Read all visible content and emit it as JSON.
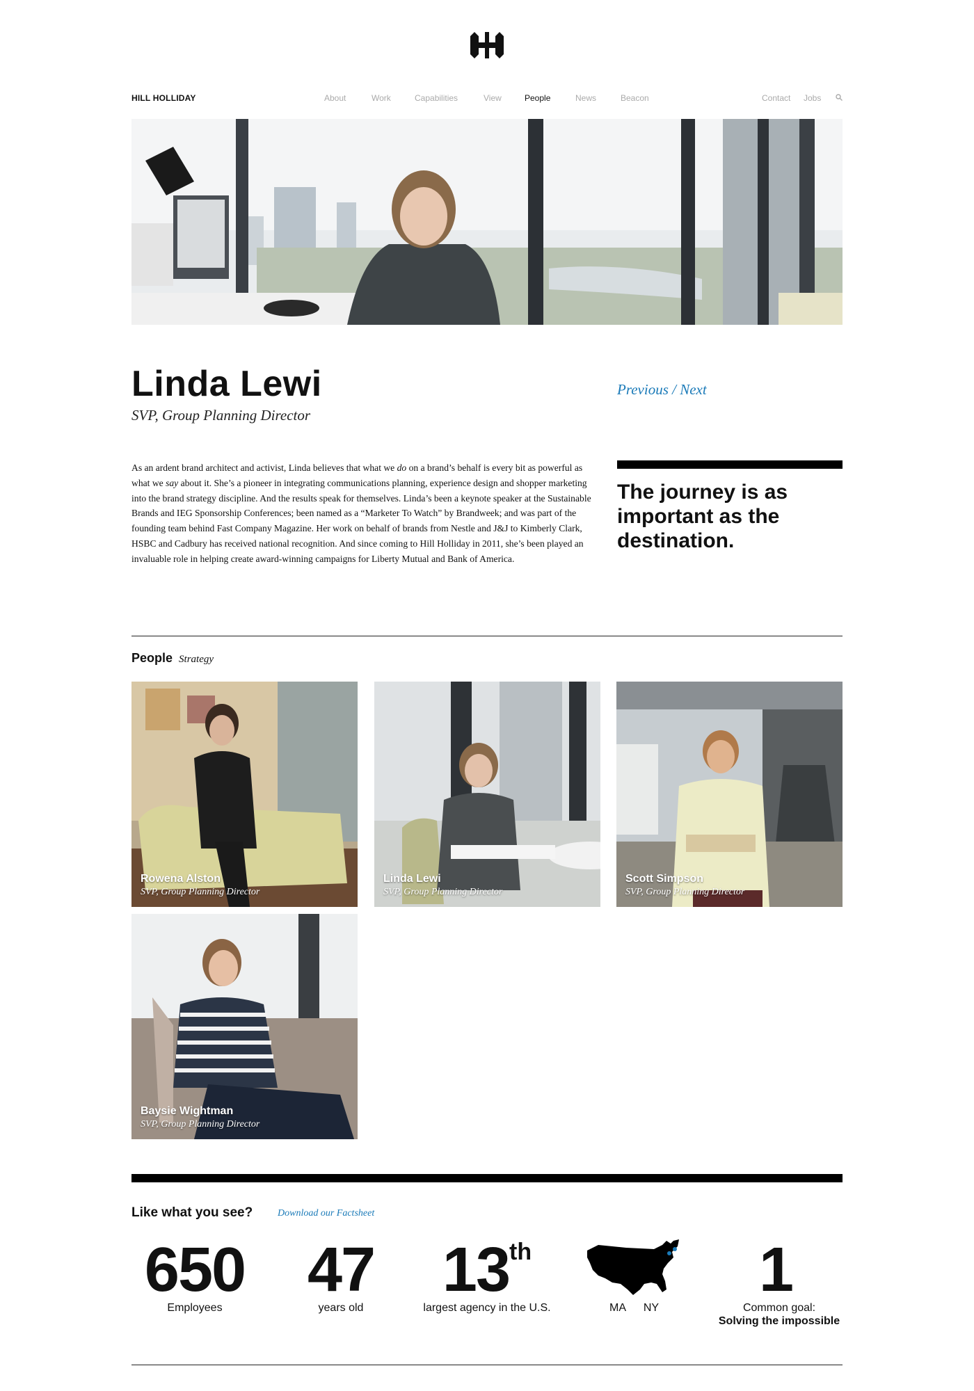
{
  "nav": {
    "brand": "HILL HOLLIDAY",
    "items": [
      "About",
      "Work",
      "Capabilities",
      "View",
      "People",
      "News",
      "Beacon"
    ],
    "active": "People",
    "right": [
      "Contact",
      "Jobs"
    ]
  },
  "profile": {
    "name": "Linda Lewi",
    "title": "SVP, Group Planning Director",
    "previous": "Previous",
    "separator": " / ",
    "next": "Next",
    "bio": {
      "part1": "As an ardent brand architect and activist, Linda believes that what we ",
      "em1": "do",
      "part2": " on a brand’s behalf is every bit as powerful as what we ",
      "em2": "say",
      "part3": " about it. She’s a pioneer in integrating communications planning, experience design and shopper marketing into the brand strategy discipline. And the results speak for themselves. Linda’s been a keynote speaker at the Sustainable Brands and IEG Sponsorship Conferences; been named as a “Marketer To Watch” by Brandweek; and was part of the founding team behind Fast Company Magazine. Her work on behalf of brands from Nestle and J&J to Kimberly Clark, HSBC and Cadbury has received national recognition. And since coming to Hill Holliday in 2011, she’s been played an invaluable role in helping create award-winning campaigns for Liberty Mutual and Bank of America."
    },
    "quote": "The journey is as important as the destination."
  },
  "people": {
    "heading": "People",
    "category": "Strategy",
    "cards": [
      {
        "name": "Rowena Alston",
        "role": "SVP, Group Planning Director"
      },
      {
        "name": "Linda Lewi",
        "role": "SVP, Group Planning Director"
      },
      {
        "name": "Scott Simpson",
        "role": "SVP, Group Planning Director"
      },
      {
        "name": "Baysie Wightman",
        "role": "SVP, Group Planning Director"
      }
    ]
  },
  "facts": {
    "heading": "Like what you see?",
    "download": "Download our Factsheet",
    "employees_num": "650",
    "employees_label": "Employees",
    "age_num": "47",
    "age_label": "years old",
    "rank_num": "13",
    "rank_sup": "th",
    "rank_label": "largest agency in the U.S.",
    "map_label_ma": "MA",
    "map_label_ny": "NY",
    "goal_num": "1",
    "goal_label": "Common goal:",
    "goal_bold": "Solving the impossible"
  },
  "colors": {
    "accent": "#1a7ab8",
    "nav_inactive": "#aaaaaa"
  }
}
